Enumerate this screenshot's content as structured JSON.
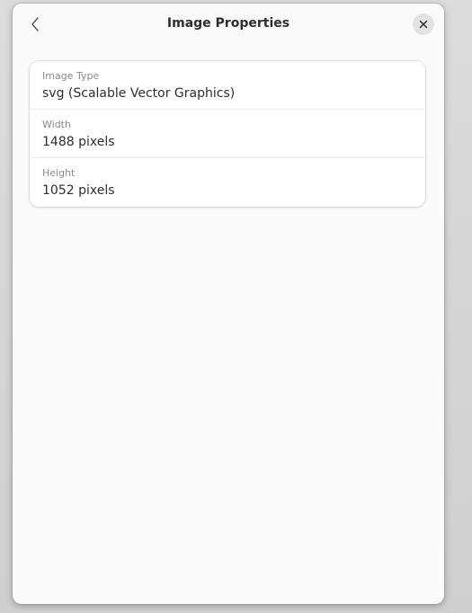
{
  "dialog": {
    "title": "Image Properties",
    "back_icon": "chevron-left-icon",
    "close_icon": "close-icon"
  },
  "properties": [
    {
      "label": "Image Type",
      "value": "svg (Scalable Vector Graphics)"
    },
    {
      "label": "Width",
      "value": "1488 pixels"
    },
    {
      "label": "Height",
      "value": "1052 pixels"
    }
  ]
}
